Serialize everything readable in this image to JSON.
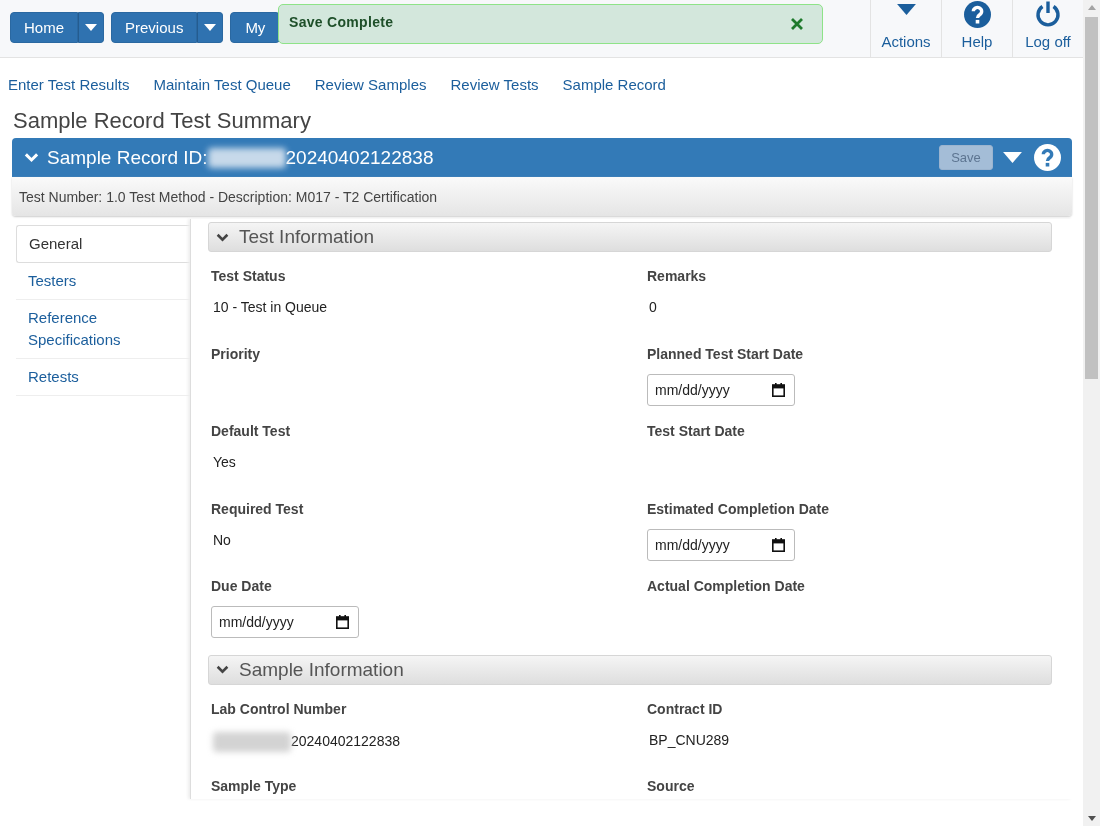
{
  "top_nav": {
    "buttons": [
      {
        "label": "Home",
        "has_menu": true
      },
      {
        "label": "Previous",
        "has_menu": true
      },
      {
        "label": "My",
        "has_menu": false
      }
    ],
    "actions": [
      {
        "kind": "menu",
        "label": "Actions"
      },
      {
        "kind": "help",
        "label": "Help"
      },
      {
        "kind": "power",
        "label": "Log off"
      }
    ]
  },
  "toast": {
    "message": "Save Complete"
  },
  "links": [
    "Enter Test Results",
    "Maintain Test Queue",
    "Review Samples",
    "Review Tests",
    "Sample Record"
  ],
  "page_title": "Sample Record Test Summary",
  "record": {
    "label": "Sample Record ID:",
    "redacted": true,
    "id": "20240402122838",
    "expanded": true,
    "save_button": {
      "label": "Save",
      "disabled": true
    },
    "summary": "Test Number: 1.0 Test Method - Description: M017 - T2 Certification"
  },
  "side_tabs": [
    {
      "label": "General",
      "selected": true
    },
    {
      "label": "Testers",
      "selected": false
    },
    {
      "label": "Reference Specifications",
      "selected": false
    },
    {
      "label": "Retests",
      "selected": false
    }
  ],
  "sections": [
    {
      "title": "Test Information",
      "expanded": true,
      "fields": [
        {
          "label": "Test Status",
          "kind": "text",
          "value": "10 - Test in Queue"
        },
        {
          "label": "Remarks",
          "kind": "text",
          "value": "0"
        },
        {
          "label": "Priority",
          "kind": "text"
        },
        {
          "label": "Planned Test Start Date",
          "kind": "date",
          "placeholder": "mm/dd/yyyy"
        },
        {
          "label": "Default Test",
          "kind": "text",
          "value": "Yes"
        },
        {
          "label": "Test Start Date",
          "kind": "text"
        },
        {
          "label": "Required Test",
          "kind": "text",
          "value": "No"
        },
        {
          "label": "Estimated Completion Date",
          "kind": "date",
          "placeholder": "mm/dd/yyyy"
        },
        {
          "label": "Due Date",
          "kind": "date",
          "placeholder": "mm/dd/yyyy"
        },
        {
          "label": "Actual Completion Date",
          "kind": "text"
        }
      ]
    },
    {
      "title": "Sample Information",
      "expanded": true,
      "fields": [
        {
          "label": "Lab Control Number",
          "kind": "text",
          "redacted": true,
          "value": "20240402122838"
        },
        {
          "label": "Contract ID",
          "kind": "text",
          "value": "BP_CNU289"
        },
        {
          "label": "Sample Type",
          "kind": "label"
        },
        {
          "label": "Source",
          "kind": "label"
        }
      ]
    }
  ]
}
